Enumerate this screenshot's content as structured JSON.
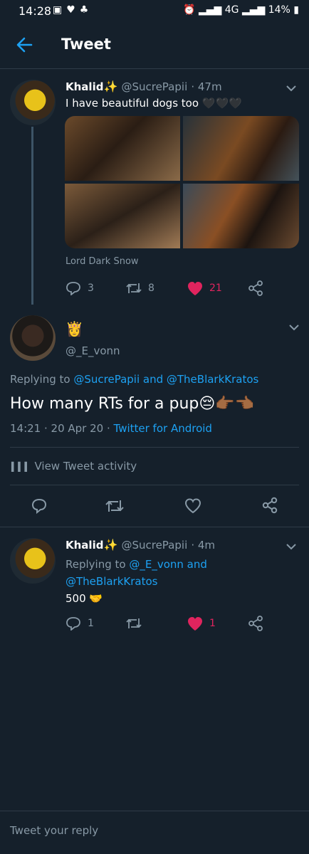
{
  "status": {
    "time": "14:28",
    "network": "4G",
    "battery": "14%"
  },
  "header": {
    "title": "Tweet"
  },
  "tweet1": {
    "name": "Khalid",
    "handle": "@SucrePapii",
    "time": "· 47m",
    "text": "I have beautiful dogs too",
    "hearts": "🖤🖤🖤",
    "caption": "Lord Dark Snow",
    "replies": "3",
    "retweets": "8",
    "likes": "21"
  },
  "main_tweet": {
    "name_emoji": "👸",
    "handle": "@_E_vonn",
    "replying_prefix": "Replying to",
    "replying_to": "@SucrePapii and @TheBlarkKratos",
    "text": "How many RTs for a pup😔👉🏾👈🏾",
    "timestamp": "14:21 · 20 Apr 20 ·",
    "client": "Twitter for Android",
    "activity": "View Tweet activity"
  },
  "tweet2": {
    "name": "Khalid",
    "handle": "@SucrePapii",
    "time": "· 4m",
    "replying_prefix": "Replying to",
    "replying_to_line1": "@_E_vonn and",
    "replying_to_line2": "@TheBlarkKratos",
    "text": "500 🤝",
    "replies": "1",
    "likes": "1"
  },
  "reply": {
    "placeholder": "Tweet your reply"
  },
  "colors": {
    "accent": "#1da1f2",
    "like": "#e0245e",
    "background": "#15202b"
  }
}
